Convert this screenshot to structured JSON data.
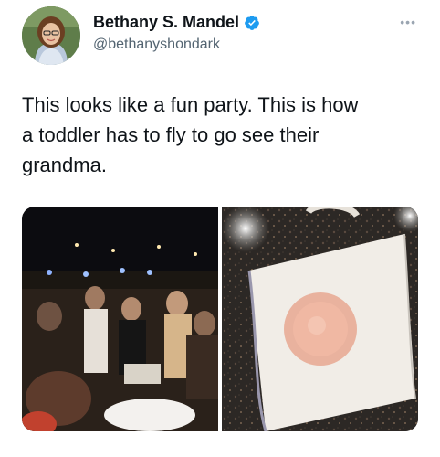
{
  "author": {
    "display_name": "Bethany S. Mandel",
    "handle": "@bethanyshondark",
    "verified": true
  },
  "tweet": {
    "text": "This looks like a fun party.  This is how\na toddler has to fly to go see their\ngrandma."
  },
  "icons": {
    "verified": "verified-badge-icon",
    "more": "more-options-icon"
  },
  "colors": {
    "verified_blue": "#1d9bf0",
    "text": "#0f1419",
    "secondary_text": "#536471"
  }
}
